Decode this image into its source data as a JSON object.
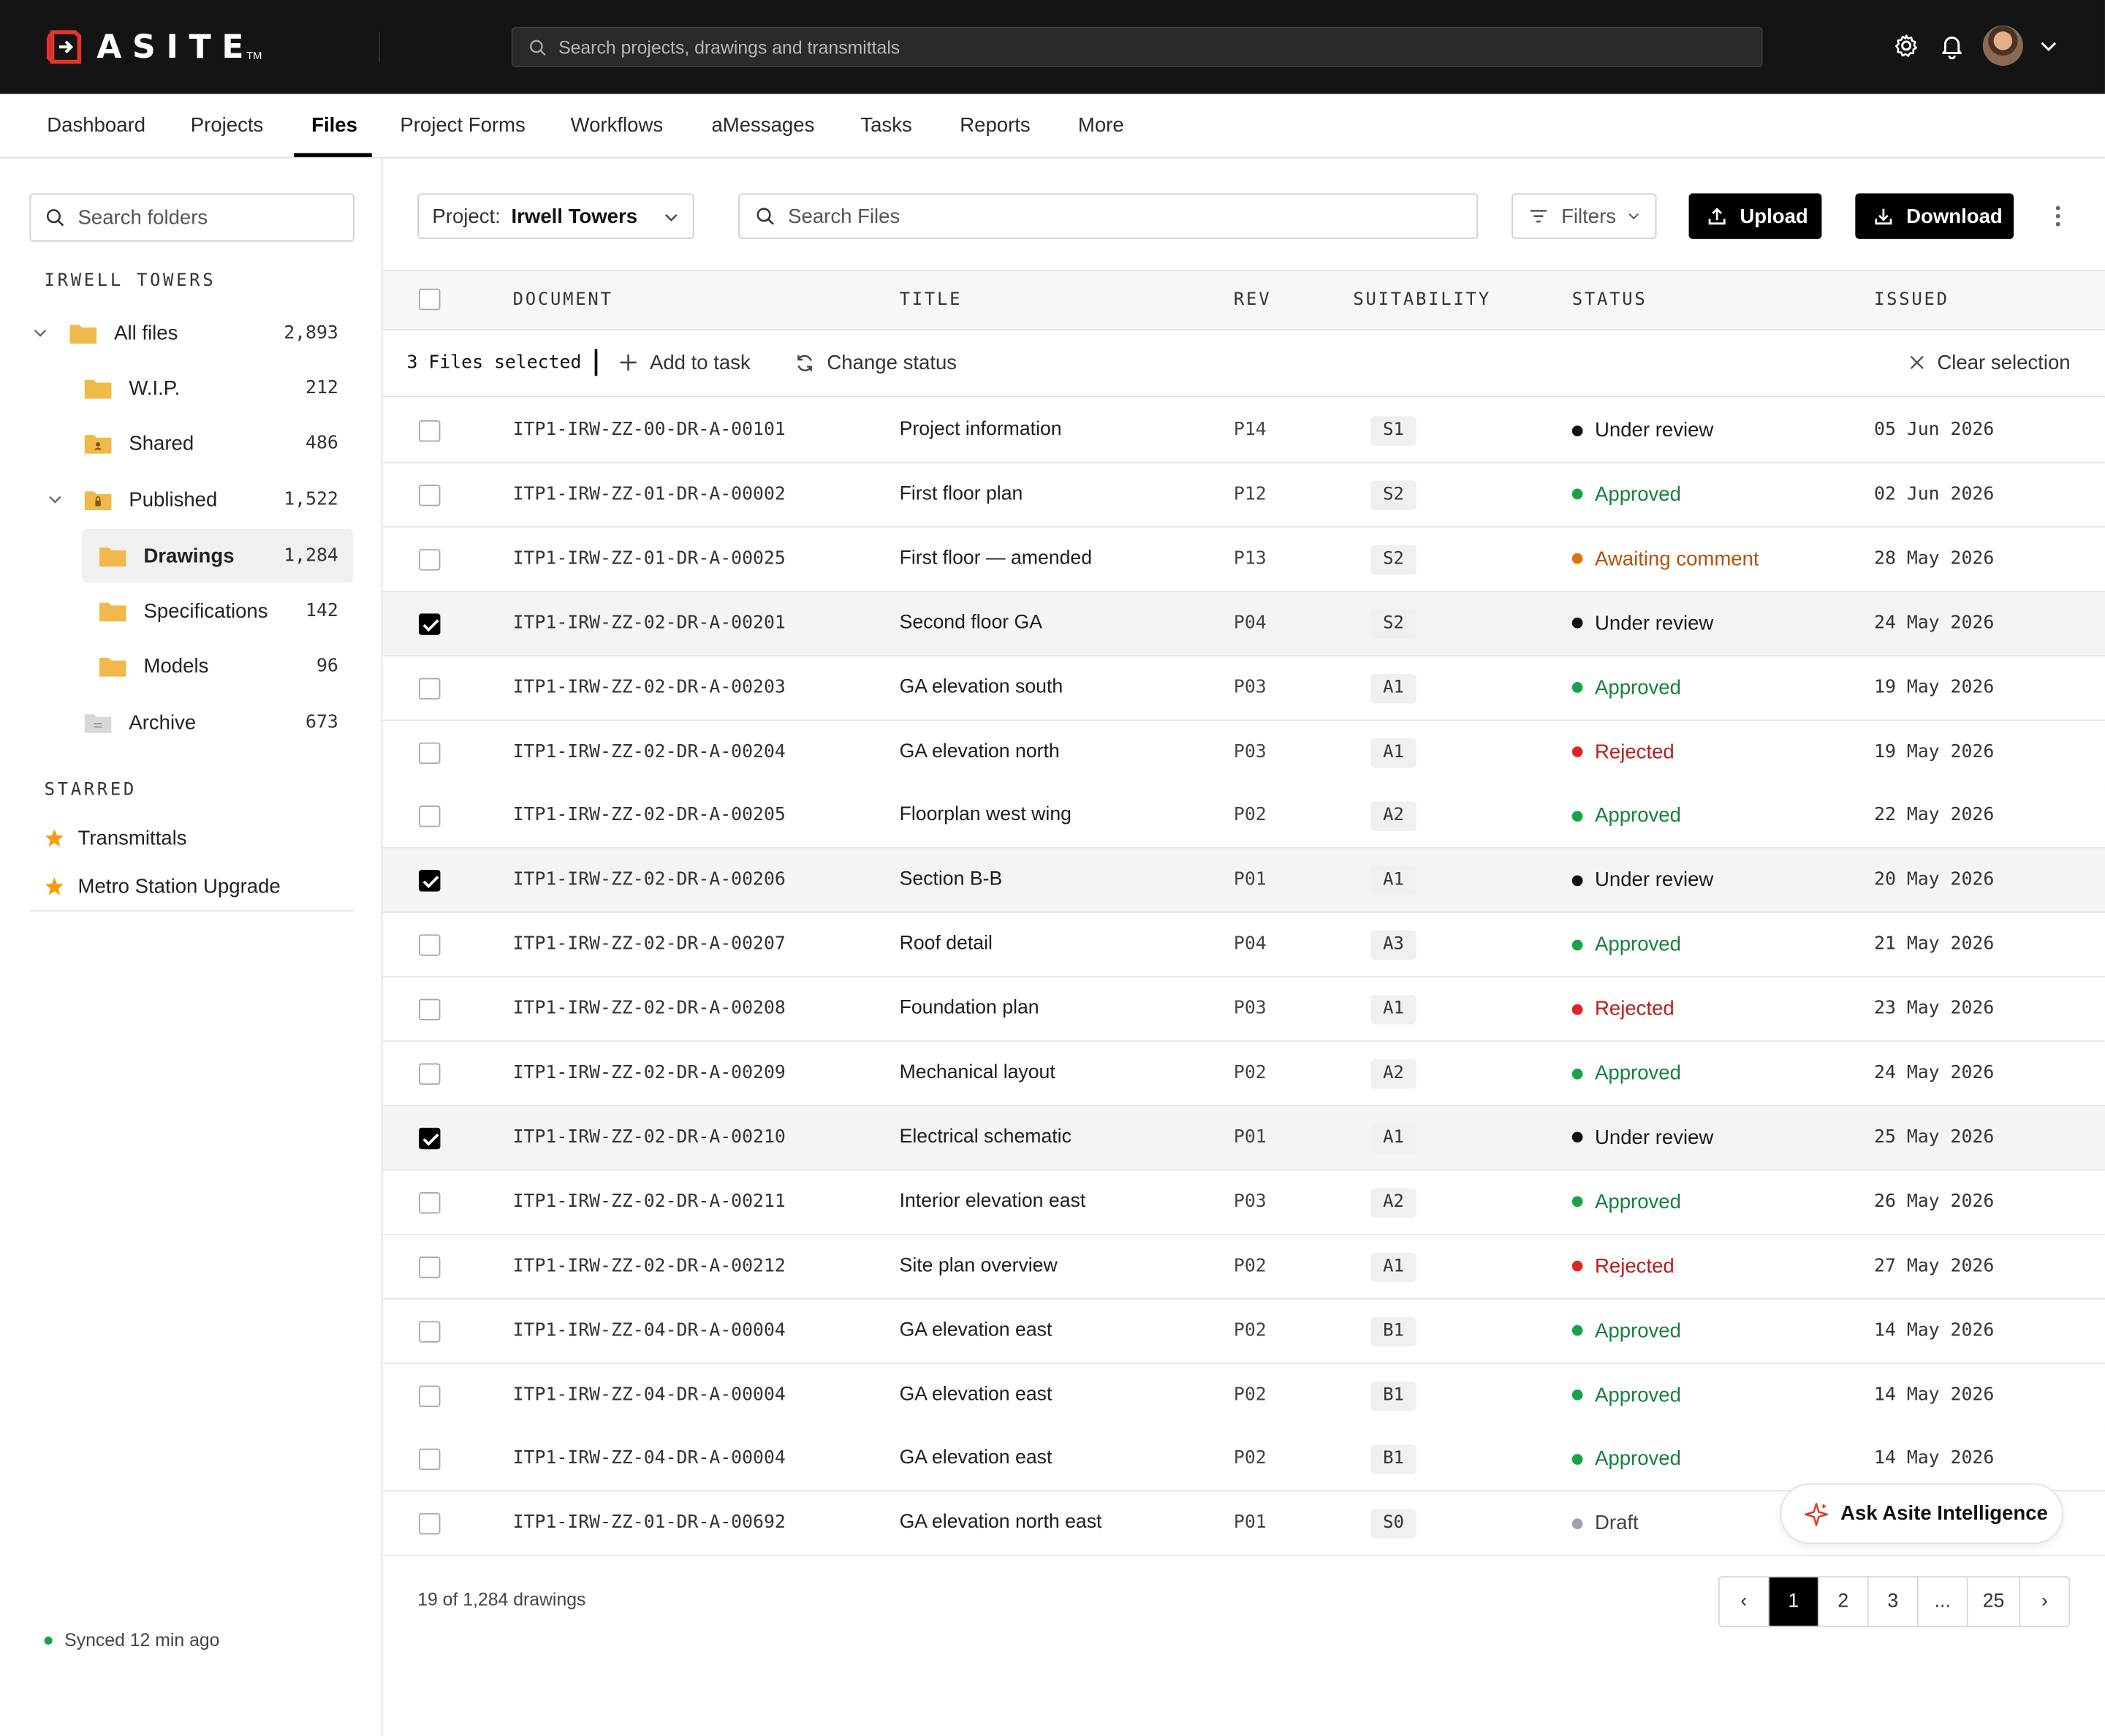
{
  "header": {
    "brand": "ASITE",
    "brand_tm": "TM",
    "search_placeholder": "Search projects, drawings and transmittals"
  },
  "nav": {
    "items": [
      "Dashboard",
      "Projects",
      "Files",
      "Project Forms",
      "Workflows",
      "aMessages",
      "Tasks",
      "Reports",
      "More"
    ],
    "active": "Files"
  },
  "sidebar": {
    "search_placeholder": "Search folders",
    "project_label": "IRWELL TOWERS",
    "tree": [
      {
        "label": "All files",
        "count": "2,893"
      },
      {
        "label": "W.I.P.",
        "count": "212"
      },
      {
        "label": "Shared",
        "count": "486"
      },
      {
        "label": "Published",
        "count": "1,522"
      },
      {
        "label": "Drawings",
        "count": "1,284"
      },
      {
        "label": "Specifications",
        "count": "142"
      },
      {
        "label": "Models",
        "count": "96"
      },
      {
        "label": "Archive",
        "count": "673"
      }
    ],
    "starred_label": "STARRED",
    "starred": [
      "Transmittals",
      "Metro Station Upgrade"
    ],
    "sync_status": "Synced 12 min ago"
  },
  "toolbar": {
    "project_key": "Project:",
    "project_value": "Irwell Towers",
    "search_placeholder": "Search Files",
    "filters_label": "Filters",
    "upload_label": "Upload",
    "download_label": "Download"
  },
  "table": {
    "columns": [
      "DOCUMENT",
      "TITLE",
      "REV",
      "SUITABILITY",
      "STATUS",
      "ISSUED"
    ],
    "selection": {
      "text": "3 Files selected",
      "add_to_task": "Add to task",
      "change_status": "Change status",
      "clear": "Clear selection"
    },
    "status_colors": {
      "Under review": "#111111",
      "Approved": "#16a34a",
      "Awaiting comment": "#d97706",
      "Rejected": "#dc2626",
      "Draft": "#9ca3af"
    },
    "status_text_colors": {
      "Under review": "#1a1a1a",
      "Approved": "#15803d",
      "Awaiting comment": "#b45309",
      "Rejected": "#b91c1c",
      "Draft": "#444444"
    },
    "rows": [
      {
        "doc": "ITP1-IRW-ZZ-00-DR-A-00101",
        "title": "Project information",
        "rev": "P14",
        "suit": "S1",
        "status": "Under review",
        "issued": "05 Jun 2026",
        "checked": false
      },
      {
        "doc": "ITP1-IRW-ZZ-01-DR-A-00002",
        "title": "First floor plan",
        "rev": "P12",
        "suit": "S2",
        "status": "Approved",
        "issued": "02 Jun 2026",
        "checked": false
      },
      {
        "doc": "ITP1-IRW-ZZ-01-DR-A-00025",
        "title": "First floor — amended",
        "rev": "P13",
        "suit": "S2",
        "status": "Awaiting comment",
        "issued": "28 May 2026",
        "checked": false
      },
      {
        "doc": "ITP1-IRW-ZZ-02-DR-A-00201",
        "title": "Second floor GA",
        "rev": "P04",
        "suit": "S2",
        "status": "Under review",
        "issued": "24 May 2026",
        "checked": true
      },
      {
        "doc": "ITP1-IRW-ZZ-02-DR-A-00203",
        "title": "GA elevation south",
        "rev": "P03",
        "suit": "A1",
        "status": "Approved",
        "issued": "19 May 2026",
        "checked": false
      },
      {
        "doc": "ITP1-IRW-ZZ-02-DR-A-00204",
        "title": "GA elevation north",
        "rev": "P03",
        "suit": "A1",
        "status": "Rejected",
        "issued": "19 May 2026",
        "checked": false
      },
      {
        "doc": "ITP1-IRW-ZZ-02-DR-A-00205",
        "title": "Floorplan west wing",
        "rev": "P02",
        "suit": "A2",
        "status": "Approved",
        "issued": "22 May 2026",
        "checked": false
      },
      {
        "doc": "ITP1-IRW-ZZ-02-DR-A-00206",
        "title": "Section B-B",
        "rev": "P01",
        "suit": "A1",
        "status": "Under review",
        "issued": "20 May 2026",
        "checked": true
      },
      {
        "doc": "ITP1-IRW-ZZ-02-DR-A-00207",
        "title": "Roof detail",
        "rev": "P04",
        "suit": "A3",
        "status": "Approved",
        "issued": "21 May 2026",
        "checked": false
      },
      {
        "doc": "ITP1-IRW-ZZ-02-DR-A-00208",
        "title": "Foundation plan",
        "rev": "P03",
        "suit": "A1",
        "status": "Rejected",
        "issued": "23 May 2026",
        "checked": false
      },
      {
        "doc": "ITP1-IRW-ZZ-02-DR-A-00209",
        "title": "Mechanical layout",
        "rev": "P02",
        "suit": "A2",
        "status": "Approved",
        "issued": "24 May 2026",
        "checked": false
      },
      {
        "doc": "ITP1-IRW-ZZ-02-DR-A-00210",
        "title": "Electrical schematic",
        "rev": "P01",
        "suit": "A1",
        "status": "Under review",
        "issued": "25 May 2026",
        "checked": true
      },
      {
        "doc": "ITP1-IRW-ZZ-02-DR-A-00211",
        "title": "Interior elevation east",
        "rev": "P03",
        "suit": "A2",
        "status": "Approved",
        "issued": "26 May 2026",
        "checked": false
      },
      {
        "doc": "ITP1-IRW-ZZ-02-DR-A-00212",
        "title": "Site plan overview",
        "rev": "P02",
        "suit": "A1",
        "status": "Rejected",
        "issued": "27 May 2026",
        "checked": false
      },
      {
        "doc": "ITP1-IRW-ZZ-04-DR-A-00004",
        "title": "GA elevation east",
        "rev": "P02",
        "suit": "B1",
        "status": "Approved",
        "issued": "14 May 2026",
        "checked": false
      },
      {
        "doc": "ITP1-IRW-ZZ-04-DR-A-00004",
        "title": "GA elevation east",
        "rev": "P02",
        "suit": "B1",
        "status": "Approved",
        "issued": "14 May 2026",
        "checked": false
      },
      {
        "doc": "ITP1-IRW-ZZ-04-DR-A-00004",
        "title": "GA elevation east",
        "rev": "P02",
        "suit": "B1",
        "status": "Approved",
        "issued": "14 May 2026",
        "checked": false
      },
      {
        "doc": "ITP1-IRW-ZZ-01-DR-A-00692",
        "title": "GA elevation north east",
        "rev": "P01",
        "suit": "S0",
        "status": "Draft",
        "issued": "",
        "checked": false
      }
    ]
  },
  "footer": {
    "count_text": "19 of 1,284 drawings",
    "pages": [
      "‹",
      "1",
      "2",
      "3",
      "...",
      "25",
      "›"
    ],
    "current_page": "1"
  },
  "assistant": {
    "label": "Ask Asite Intelligence"
  },
  "colors": {
    "topbar": "#141414",
    "brand_red": "#e5352b",
    "folder": "#f0b94a",
    "star": "#f59e0b"
  }
}
